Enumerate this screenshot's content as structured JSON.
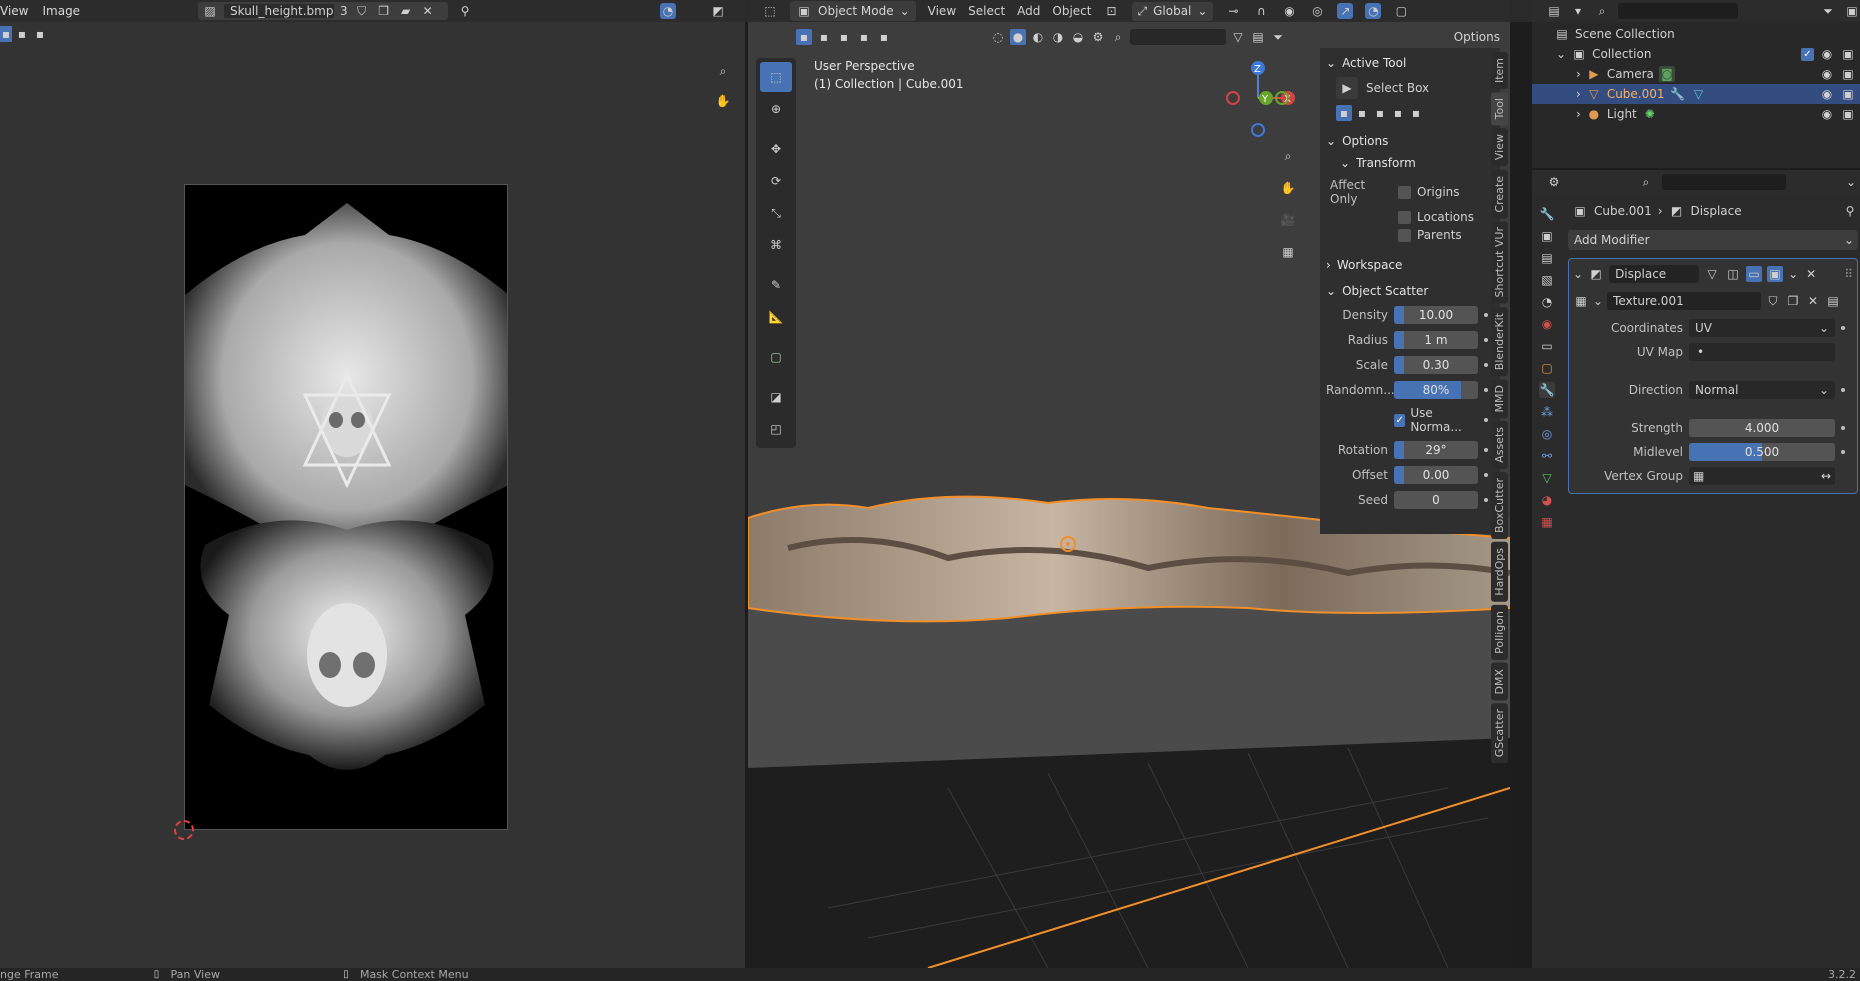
{
  "image_editor": {
    "menu": [
      "View",
      "Image"
    ],
    "image_name": "Skull_height.bmp",
    "users_count": "3"
  },
  "viewport": {
    "mode": "Object Mode",
    "menu": [
      "View",
      "Select",
      "Add",
      "Object"
    ],
    "orientation": "Global",
    "options_label": "Options",
    "overlay_title": "User Perspective",
    "overlay_subtitle": "(1) Collection | Cube.001",
    "gizmo_axes": [
      "Z",
      "Y",
      "X"
    ]
  },
  "sidebar": {
    "active_tool_header": "Active Tool",
    "active_tool_name": "Select Box",
    "options_header": "Options",
    "transform_header": "Transform",
    "affect_only_label": "Affect Only",
    "affect_items": [
      "Origins",
      "Locations",
      "Parents"
    ],
    "workspace_header": "Workspace",
    "scatter_header": "Object Scatter",
    "scatter": [
      {
        "label": "Density",
        "value": "10.00",
        "fill": 0.12
      },
      {
        "label": "Radius",
        "value": "1 m",
        "fill": 0.12
      },
      {
        "label": "Scale",
        "value": "0.30",
        "fill": 0.12
      },
      {
        "label": "Randomn...",
        "value": "80%",
        "fill": 0.8
      },
      {
        "label": "Rotation",
        "value": "29°",
        "fill": 0.12
      },
      {
        "label": "Offset",
        "value": "0.00",
        "fill": 0.12
      },
      {
        "label": "Seed",
        "value": "0",
        "fill": 0
      }
    ],
    "use_normal_label": "Use Norma...",
    "tabs": [
      "Item",
      "Tool",
      "View",
      "Create",
      "Shortcut VUr",
      "BlenderKit",
      "MMD",
      "Assets",
      "BoxCutter",
      "HardOps",
      "Polligon",
      "DMX",
      "GScatter"
    ]
  },
  "outliner": {
    "scene_collection": "Scene Collection",
    "collection": "Collection",
    "items": [
      "Camera",
      "Cube.001",
      "Light"
    ]
  },
  "properties": {
    "breadcrumb_object": "Cube.001",
    "breadcrumb_modifier": "Displace",
    "add_modifier": "Add Modifier",
    "modifier_name": "Displace",
    "texture_name": "Texture.001",
    "coordinates_label": "Coordinates",
    "coordinates_value": "UV",
    "uvmap_label": "UV Map",
    "direction_label": "Direction",
    "direction_value": "Normal",
    "strength_label": "Strength",
    "strength_value": "4.000",
    "midlevel_label": "Midlevel",
    "midlevel_value": "0.500",
    "midlevel_fill": 0.5,
    "vertex_group_label": "Vertex Group"
  },
  "statusbar": {
    "items": [
      "nge Frame",
      "Pan View",
      "Mask Context Menu"
    ],
    "version": "3.2.2"
  },
  "colors": {
    "accent": "#4772b3",
    "selection_outline": "#f0902a",
    "panel": "#303030",
    "background": "#1d1d1d"
  }
}
